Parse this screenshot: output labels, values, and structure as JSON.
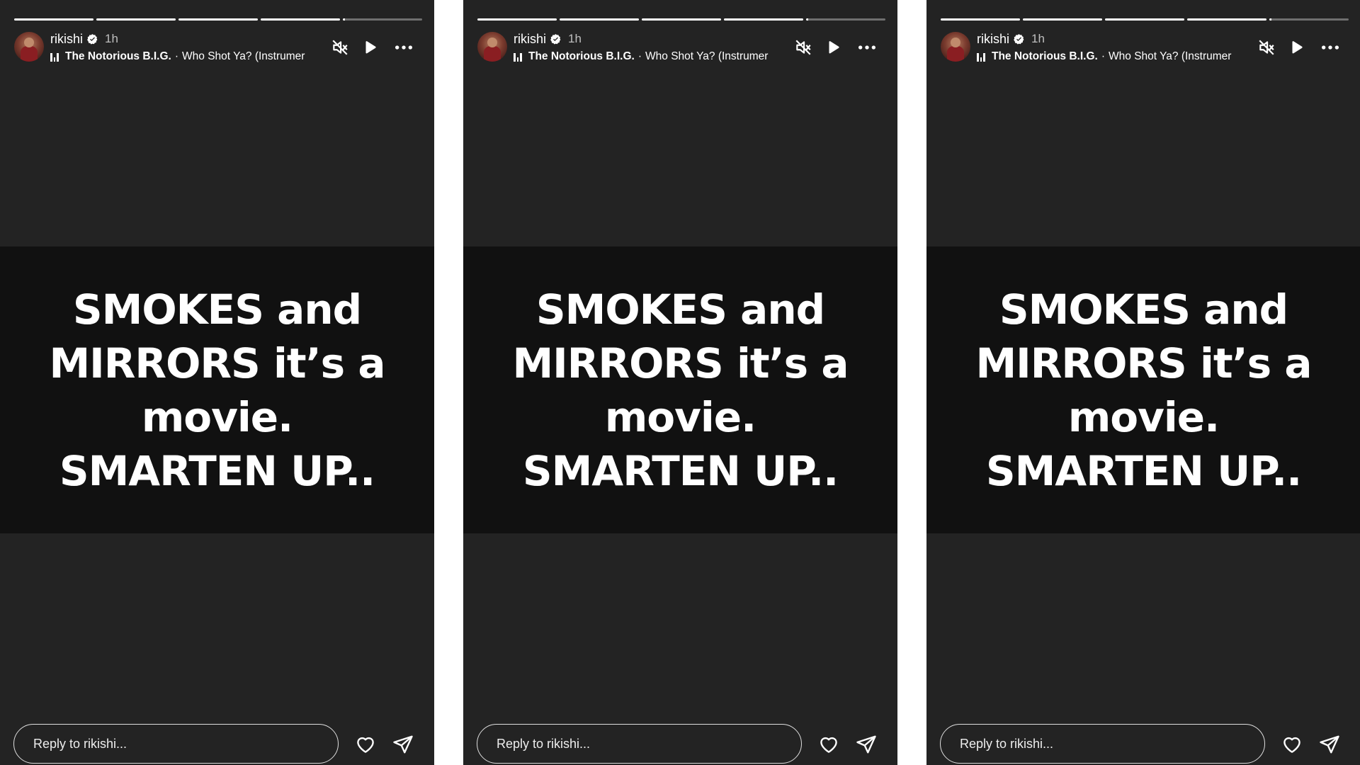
{
  "stories": [
    {
      "username": "rikishi",
      "time": "1h",
      "music": {
        "artist": "The Notorious B.I.G.",
        "separator": "·",
        "track": "Who Shot Ya? (Instrumer"
      },
      "text_lines": [
        "SMOKES and",
        "MIRRORS it’s a",
        "movie.",
        "SMARTEN UP.."
      ],
      "reply_placeholder": "Reply to rikishi...",
      "progress": [
        1,
        1,
        1,
        1,
        0.03
      ]
    },
    {
      "username": "rikishi",
      "time": "1h",
      "music": {
        "artist": "The Notorious B.I.G.",
        "separator": "·",
        "track": "Who Shot Ya? (Instrumer"
      },
      "text_lines": [
        "SMOKES and",
        "MIRRORS it’s a",
        "movie.",
        "SMARTEN UP.."
      ],
      "reply_placeholder": "Reply to rikishi...",
      "progress": [
        1,
        1,
        1,
        1,
        0.03
      ]
    },
    {
      "username": "rikishi",
      "time": "1h",
      "music": {
        "artist": "The Notorious B.I.G.",
        "separator": "·",
        "track": "Who Shot Ya? (Instrumer"
      },
      "text_lines": [
        "SMOKES and",
        "MIRRORS it’s a",
        "movie.",
        "SMARTEN UP.."
      ],
      "reply_placeholder": "Reply to rikishi...",
      "progress": [
        1,
        1,
        1,
        1,
        0.03
      ]
    }
  ],
  "icons": {
    "verified": "verified-badge-icon",
    "music": "audio-bars-icon",
    "mute": "speaker-muted-icon",
    "play": "play-icon",
    "more": "more-options-icon",
    "like": "heart-icon",
    "share": "send-icon"
  },
  "colors": {
    "story_background": "#232323",
    "text_band": "#111111",
    "text": "#ffffff",
    "page_background": "#ffffff"
  }
}
